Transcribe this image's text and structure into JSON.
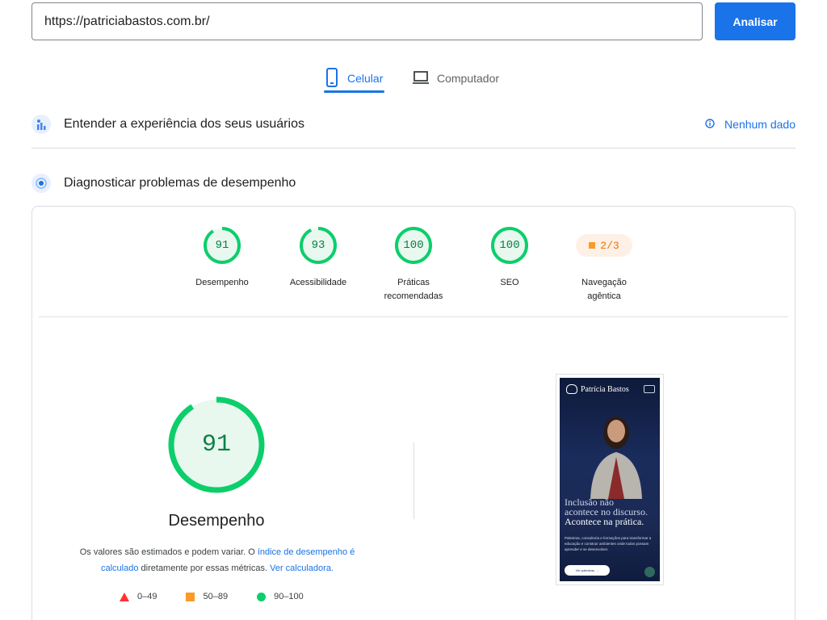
{
  "url_bar": {
    "value": "https://patriciabastos.com.br/",
    "button_label": "Analisar"
  },
  "tabs": [
    {
      "label": "Celular",
      "icon": "smartphone-icon",
      "active": true
    },
    {
      "label": "Computador",
      "icon": "laptop-icon",
      "active": false
    }
  ],
  "field_data": {
    "title": "Entender a experiência dos seus usuários",
    "status": "Nenhum dado"
  },
  "lab_data": {
    "title": "Diagnosticar problemas de desempenho"
  },
  "categories": [
    {
      "score": "91",
      "label": "Desempenho",
      "fraction": 0.91
    },
    {
      "score": "93",
      "label": "Acessibilidade",
      "fraction": 0.93
    },
    {
      "score": "100",
      "label": "Práticas recomendadas",
      "fraction": 1.0
    },
    {
      "score": "100",
      "label": "SEO",
      "fraction": 1.0
    },
    {
      "score": "2/3",
      "label": "Navegação agêntica"
    }
  ],
  "performance": {
    "score": "91",
    "fraction": 0.91,
    "title": "Desempenho",
    "note_part1": "Os valores são estimados e podem variar. O ",
    "note_link1": "índice de desempenho é calculado",
    "note_part2": " diretamente por essas métricas. ",
    "note_link2": "Ver calculadora."
  },
  "legend": [
    {
      "range": "0–49",
      "shape": "triangle",
      "color": "#ff3333"
    },
    {
      "range": "50–89",
      "shape": "square",
      "color": "#fa9b28"
    },
    {
      "range": "90–100",
      "shape": "circle",
      "color": "#0cce6b"
    }
  ],
  "screenshot": {
    "brand": "Patrícia Bastos",
    "headline_1": "Inclusão não",
    "headline_2": "acontece no discurso.",
    "headline_3": "Acontece na prática.",
    "body": "Palestras, consultoria e formações para transformar a educação e construir ambientes onde todos possam aprender e se desenvolver.",
    "cta": "Ver palestras →"
  },
  "colors": {
    "accent": "#1a73e8",
    "pass": "#0cce6b",
    "pass_text": "#0b8043",
    "average": "#fa9b28",
    "fail": "#ff3333"
  }
}
